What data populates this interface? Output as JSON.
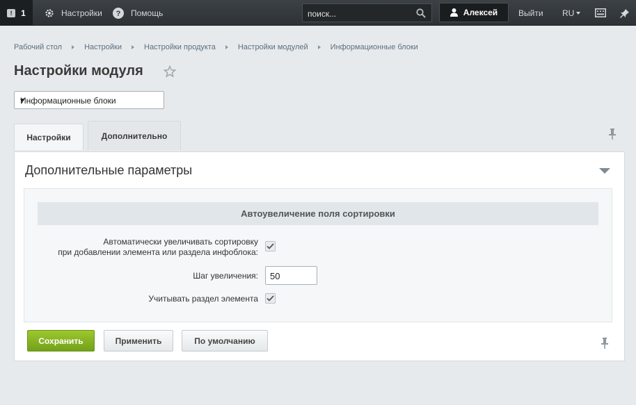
{
  "topbar": {
    "notifications_count": "1",
    "settings_label": "Настройки",
    "help_label": "Помощь",
    "search_placeholder": "поиск...",
    "user_name": "Алексей",
    "logout_label": "Выйти",
    "language": "RU"
  },
  "breadcrumbs": [
    "Рабочий стол",
    "Настройки",
    "Настройки продукта",
    "Настройки модулей",
    "Информационные блоки"
  ],
  "page_title": "Настройки модуля",
  "module_select": {
    "value": "Информационные блоки"
  },
  "tabs": [
    {
      "label": "Настройки"
    },
    {
      "label": "Дополнительно"
    }
  ],
  "panel": {
    "title": "Дополнительные параметры",
    "section_title": "Автоувеличение поля сортировки",
    "fields": {
      "auto_increment_line1": "Автоматически увеличивать сортировку",
      "auto_increment_line2": "при добавлении элемента или раздела инфоблока:",
      "step_label": "Шаг увеличения:",
      "step_value": "50",
      "consider_section_label": "Учитывать раздел элемента"
    }
  },
  "buttons": {
    "save": "Сохранить",
    "apply": "Применить",
    "default": "По умолчанию"
  },
  "colors": {
    "topbar": "#33373b",
    "save_button": "#86b224",
    "background": "#e7eaec"
  }
}
